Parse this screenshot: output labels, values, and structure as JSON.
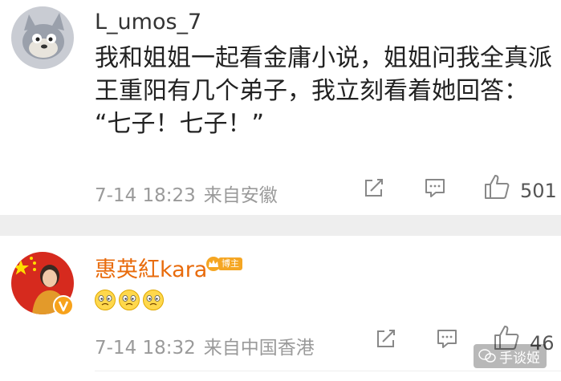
{
  "comments": [
    {
      "username": "L_umos_7",
      "content_lines": [
        "我和姐姐一起看金庸小说，姐姐问我全真派",
        "王重阳有几个弟子，我立刻看着她回答：",
        "“七子！七子！”"
      ],
      "timestamp": "7-14 18:23",
      "source": "来自安徽",
      "like_count": "501",
      "icons": [
        "cartoon-cat-avatar",
        "repost-icon",
        "comment-icon",
        "like-icon"
      ]
    },
    {
      "username": "惠英紅kara",
      "badge_label": "博主",
      "emojis": [
        "emoji-face",
        "emoji-face",
        "emoji-face"
      ],
      "timestamp": "7-14 18:32",
      "source": "来自中国香港",
      "like_count": "46",
      "icons": [
        "user-avatar",
        "verified-v-icon",
        "crown-icon",
        "repost-icon",
        "comment-icon",
        "like-icon"
      ]
    }
  ],
  "watermark": {
    "text": "手谈姬"
  },
  "colors": {
    "username_default": "#333333",
    "username_vip": "#e86b0c",
    "meta_gray": "#9a9a9a",
    "separator": "#eeeeee",
    "badge": "#f5a623"
  }
}
